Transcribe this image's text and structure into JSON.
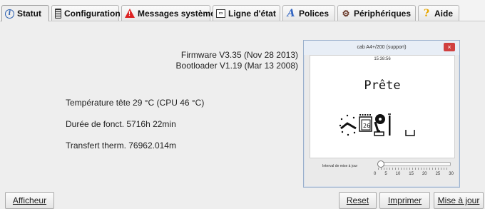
{
  "tabs": [
    {
      "label": "Statut",
      "icon": "info-icon",
      "active": true
    },
    {
      "label": "Configuration",
      "icon": "config-icon"
    },
    {
      "label": "Messages systèmes",
      "icon": "warning-icon"
    },
    {
      "label": "Ligne d'état",
      "icon": "status-line-icon"
    },
    {
      "label": "Polices",
      "icon": "font-icon"
    },
    {
      "label": "Périphériques",
      "icon": "peripherals-icon"
    },
    {
      "label": "Aide",
      "icon": "help-icon"
    }
  ],
  "info": {
    "firmware": "Firmware V3.35 (Nov 28 2013)",
    "bootloader": "Bootloader V1.19 (Mar 13 2008)",
    "temperature": "Température tête 29 °C (CPU 46 °C)",
    "runtime": "Durée de fonct. 5716h 22min",
    "transfer": "Transfert therm. 76962.014m"
  },
  "preview": {
    "title": "cab A4+/200 (support)",
    "close": "×",
    "time": "15:38:56",
    "status": "Prête",
    "calendar_day": "26",
    "slider_label": "Interval de mise à jour",
    "slider_ticks": [
      "0",
      "5",
      "10",
      "15",
      "20",
      "25",
      "30"
    ],
    "slider_value": 0
  },
  "buttons": {
    "display": "Afficheur",
    "reset": "Reset",
    "print": "Imprimer",
    "update": "Mise à jour"
  }
}
